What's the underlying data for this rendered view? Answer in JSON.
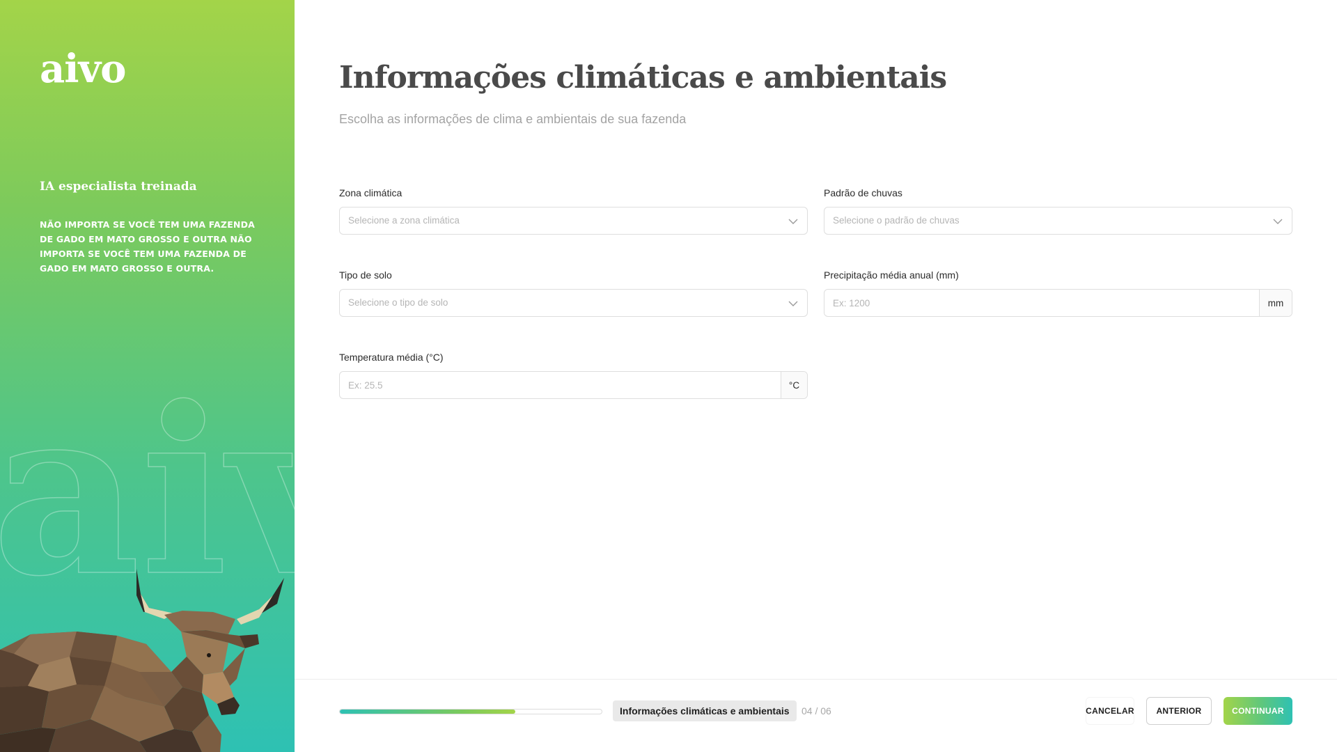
{
  "sidebar": {
    "logo": "aivo",
    "heading": "IA especialista treinada",
    "text": "NÃO IMPORTA SE VOCÊ TEM UMA FAZENDA DE GADO EM MATO GROSSO E OUTRA NÃO IMPORTA SE VOCÊ TEM UMA FAZENDA DE GADO EM MATO GROSSO E OUTRA.",
    "watermark": "aivo"
  },
  "main": {
    "title": "Informações climáticas e ambientais",
    "subtitle": "Escolha as informações de clima e ambientais de sua fazenda"
  },
  "form": {
    "climate_zone": {
      "label": "Zona climática",
      "placeholder": "Selecione a zona climática"
    },
    "rain_pattern": {
      "label": "Padrão de chuvas",
      "placeholder": "Selecione o padrão de chuvas"
    },
    "soil_type": {
      "label": "Tipo de solo",
      "placeholder": "Selecione o tipo de solo"
    },
    "precipitation": {
      "label": "Precipitação média anual (mm)",
      "placeholder": "Ex: 1200",
      "unit": "mm"
    },
    "temperature": {
      "label": "Temperatura média (°C)",
      "placeholder": "Ex: 25.5",
      "unit": "°C"
    }
  },
  "footer": {
    "progress": 0.67,
    "step_name": "Informações climáticas e ambientais",
    "step_count": "04 / 06",
    "cancel_label": "CANCELAR",
    "previous_label": "ANTERIOR",
    "continue_label": "CONTINUAR"
  },
  "colors": {
    "brand_green": "#a3d449",
    "brand_teal": "#2ec1b3",
    "title": "#4a4a4a"
  },
  "icons": {
    "dropdown": "chevron-down-icon",
    "bull": "bull-illustration"
  }
}
